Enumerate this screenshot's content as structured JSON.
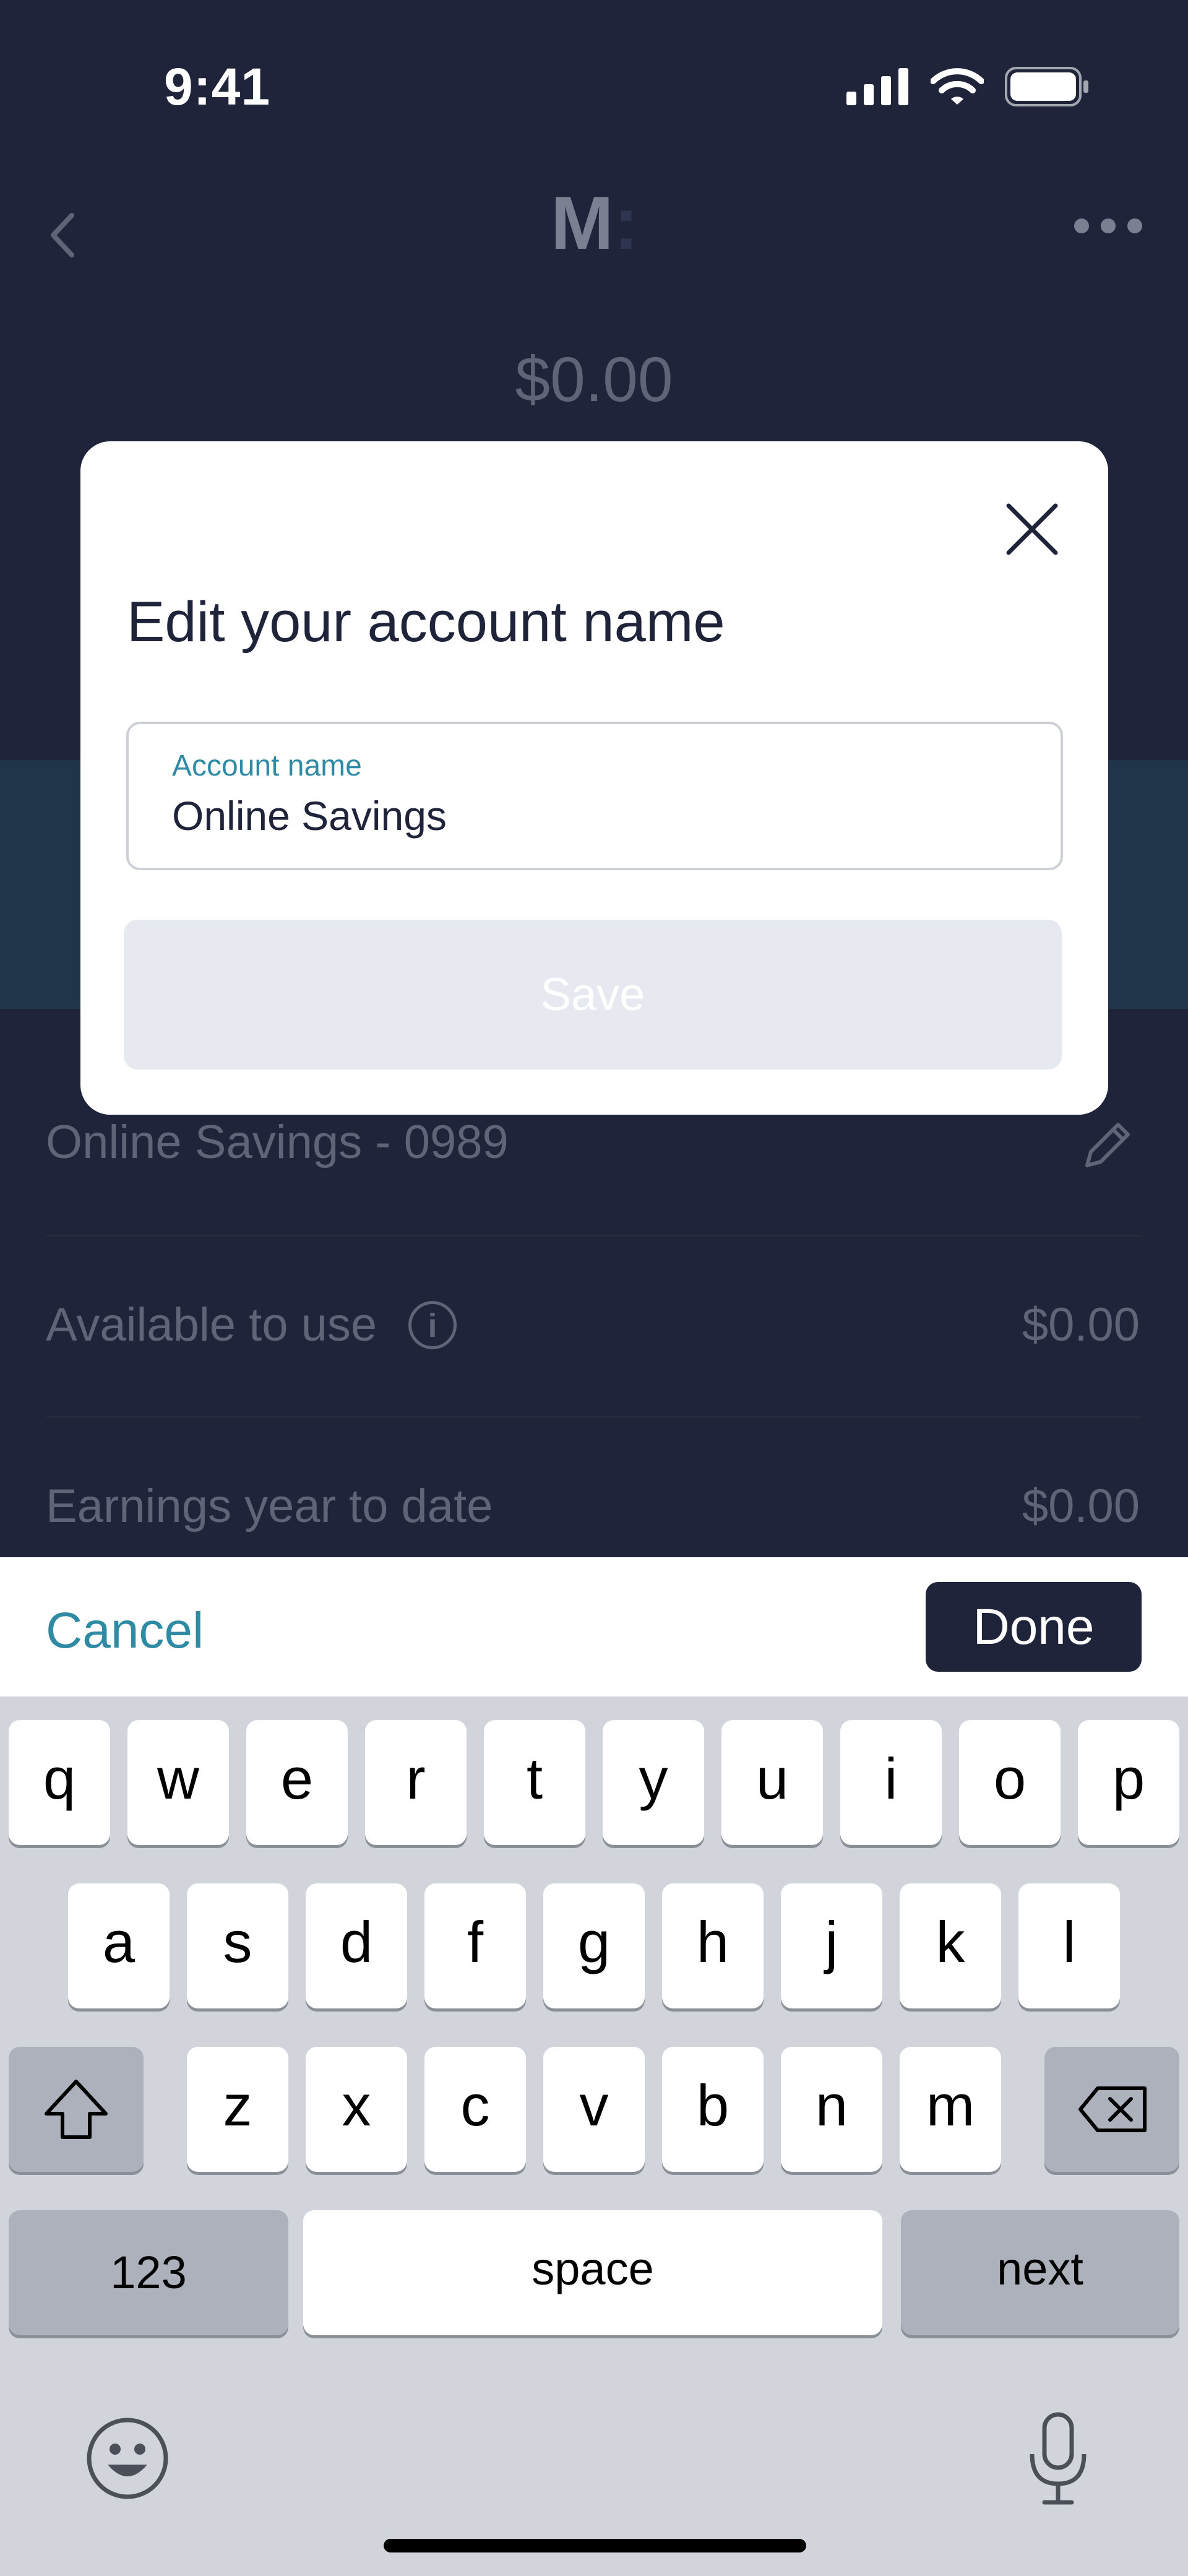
{
  "status_bar": {
    "time": "9:41",
    "icons": [
      "signal-icon",
      "wifi-icon",
      "battery-icon"
    ]
  },
  "header": {
    "logo_letter": "M",
    "logo_colon": ":",
    "balance": "$0.00"
  },
  "account_rows": [
    {
      "label": "Online Savings - 0989",
      "icon": "pencil-icon"
    },
    {
      "label": "Available to use",
      "value": "$0.00",
      "icon": "info-icon",
      "icon_glyph": "i"
    },
    {
      "label": "Earnings year to date",
      "value": "$0.00"
    }
  ],
  "modal": {
    "title": "Edit your account name",
    "field_label": "Account name",
    "field_value": "Online Savings",
    "save_label": "Save"
  },
  "accessory": {
    "cancel_label": "Cancel",
    "done_label": "Done"
  },
  "keyboard": {
    "row1": [
      "q",
      "w",
      "e",
      "r",
      "t",
      "y",
      "u",
      "i",
      "o",
      "p"
    ],
    "row2": [
      "a",
      "s",
      "d",
      "f",
      "g",
      "h",
      "j",
      "k",
      "l"
    ],
    "row3": [
      "z",
      "x",
      "c",
      "v",
      "b",
      "n",
      "m"
    ],
    "numbers_label": "123",
    "space_label": "space",
    "next_label": "next"
  },
  "colors": {
    "accent": "#2f8aa4",
    "navy": "#20243b",
    "save_disabled": "#e6e9ef"
  }
}
